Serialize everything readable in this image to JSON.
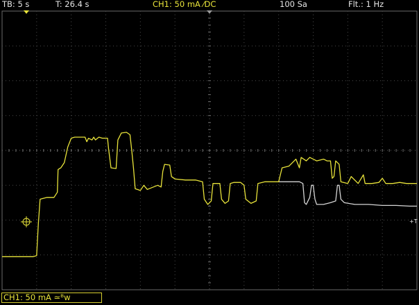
{
  "status": {
    "timebase": "TB: 5 s",
    "trigger_time": "T: 26.4 s",
    "channel": "CH1: 50 mA ⁄DC",
    "samples": "100 Sa",
    "filter": "Flt.: 1 Hz"
  },
  "channel_label": "CH1: 50 mA ≃ᴮw",
  "trigger_marker": "+T",
  "colors": {
    "trace_yellow": "#e8e33a",
    "trace_white": "#d6d6d6",
    "grid": "#4a4a4a",
    "background": "#000000"
  },
  "chart_data": {
    "type": "line",
    "x_unit": "divisions",
    "y_unit": "divisions",
    "xlim": [
      0,
      12
    ],
    "ylim": [
      -4,
      4
    ],
    "series": [
      {
        "color": "#e8e33a",
        "points": [
          [
            0.0,
            -3.05
          ],
          [
            0.9,
            -3.05
          ],
          [
            1.0,
            -3.02
          ],
          [
            1.05,
            -2.1
          ],
          [
            1.1,
            -1.4
          ],
          [
            1.3,
            -1.35
          ],
          [
            1.5,
            -1.35
          ],
          [
            1.6,
            -1.2
          ],
          [
            1.62,
            -0.55
          ],
          [
            1.7,
            -0.5
          ],
          [
            1.8,
            -0.35
          ],
          [
            1.9,
            0.1
          ],
          [
            2.0,
            0.35
          ],
          [
            2.1,
            0.38
          ],
          [
            2.4,
            0.38
          ],
          [
            2.45,
            0.25
          ],
          [
            2.5,
            0.35
          ],
          [
            2.6,
            0.3
          ],
          [
            2.65,
            0.38
          ],
          [
            2.7,
            0.3
          ],
          [
            2.8,
            0.38
          ],
          [
            2.9,
            0.35
          ],
          [
            3.05,
            0.35
          ],
          [
            3.08,
            0.05
          ],
          [
            3.15,
            -0.5
          ],
          [
            3.3,
            -0.52
          ],
          [
            3.35,
            0.3
          ],
          [
            3.45,
            0.5
          ],
          [
            3.6,
            0.52
          ],
          [
            3.7,
            0.45
          ],
          [
            3.75,
            0.0
          ],
          [
            3.8,
            -0.5
          ],
          [
            3.85,
            -1.1
          ],
          [
            4.0,
            -1.15
          ],
          [
            4.1,
            -1.0
          ],
          [
            4.2,
            -1.12
          ],
          [
            4.3,
            -1.08
          ],
          [
            4.5,
            -1.0
          ],
          [
            4.6,
            -1.05
          ],
          [
            4.65,
            -0.6
          ],
          [
            4.7,
            -0.4
          ],
          [
            4.85,
            -0.42
          ],
          [
            4.9,
            -0.75
          ],
          [
            5.0,
            -0.82
          ],
          [
            5.3,
            -0.85
          ],
          [
            5.6,
            -0.85
          ],
          [
            5.8,
            -0.9
          ],
          [
            5.85,
            -1.4
          ],
          [
            5.95,
            -1.55
          ],
          [
            6.05,
            -1.45
          ],
          [
            6.1,
            -0.95
          ],
          [
            6.2,
            -0.95
          ],
          [
            6.3,
            -0.95
          ],
          [
            6.35,
            -1.4
          ],
          [
            6.45,
            -1.52
          ],
          [
            6.55,
            -1.45
          ],
          [
            6.6,
            -0.95
          ],
          [
            6.7,
            -0.92
          ],
          [
            6.9,
            -0.92
          ],
          [
            7.0,
            -1.0
          ],
          [
            7.05,
            -1.4
          ],
          [
            7.2,
            -1.52
          ],
          [
            7.35,
            -1.45
          ],
          [
            7.4,
            -0.95
          ],
          [
            7.6,
            -0.9
          ],
          [
            8.0,
            -0.9
          ],
          [
            8.1,
            -0.5
          ],
          [
            8.3,
            -0.45
          ],
          [
            8.5,
            -0.25
          ],
          [
            8.6,
            -0.5
          ],
          [
            8.65,
            -0.2
          ],
          [
            8.8,
            -0.3
          ],
          [
            8.9,
            -0.2
          ],
          [
            9.1,
            -0.3
          ],
          [
            9.3,
            -0.25
          ],
          [
            9.4,
            -0.3
          ],
          [
            9.5,
            -0.3
          ],
          [
            9.55,
            -0.8
          ],
          [
            9.6,
            -0.75
          ],
          [
            9.65,
            -0.3
          ],
          [
            9.75,
            -0.4
          ],
          [
            9.8,
            -0.9
          ],
          [
            10.0,
            -0.95
          ],
          [
            10.1,
            -0.75
          ],
          [
            10.3,
            -0.95
          ],
          [
            10.45,
            -0.7
          ],
          [
            10.5,
            -0.95
          ],
          [
            10.7,
            -0.95
          ],
          [
            10.9,
            -0.92
          ],
          [
            11.0,
            -0.8
          ],
          [
            11.1,
            -0.95
          ],
          [
            11.3,
            -0.95
          ],
          [
            11.5,
            -0.92
          ],
          [
            11.7,
            -0.95
          ],
          [
            12.0,
            -0.95
          ]
        ]
      },
      {
        "color": "#d6d6d6",
        "points": [
          [
            8.0,
            -0.9
          ],
          [
            8.2,
            -0.9
          ],
          [
            8.4,
            -0.9
          ],
          [
            8.6,
            -0.9
          ],
          [
            8.7,
            -0.95
          ],
          [
            8.75,
            -1.5
          ],
          [
            8.8,
            -1.55
          ],
          [
            8.9,
            -1.35
          ],
          [
            8.95,
            -1.0
          ],
          [
            9.0,
            -1.0
          ],
          [
            9.05,
            -1.4
          ],
          [
            9.1,
            -1.55
          ],
          [
            9.3,
            -1.55
          ],
          [
            9.5,
            -1.5
          ],
          [
            9.65,
            -1.45
          ],
          [
            9.7,
            -1.0
          ],
          [
            9.75,
            -1.0
          ],
          [
            9.8,
            -1.4
          ],
          [
            9.9,
            -1.5
          ],
          [
            10.2,
            -1.55
          ],
          [
            10.6,
            -1.55
          ],
          [
            11.0,
            -1.58
          ],
          [
            11.4,
            -1.58
          ],
          [
            11.8,
            -1.6
          ],
          [
            12.0,
            -1.6
          ]
        ]
      }
    ]
  }
}
